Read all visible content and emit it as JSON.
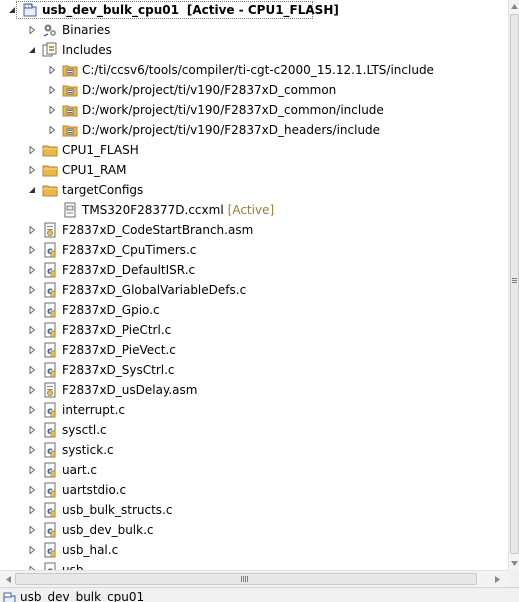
{
  "explorer": {
    "root": {
      "name": "usb_dev_bulk_cpu01",
      "suffix": "[Active - CPU1_FLASH]",
      "icon": "ccs-project-icon",
      "expanded": true
    },
    "rows": [
      {
        "depth": 1,
        "twisty": "collapsed",
        "icon": "binaries",
        "label": "Binaries",
        "name": "tree-item-binaries"
      },
      {
        "depth": 1,
        "twisty": "expanded",
        "icon": "includes",
        "label": "Includes",
        "name": "tree-item-includes"
      },
      {
        "depth": 2,
        "twisty": "collapsed",
        "icon": "include-folder",
        "label": "C:/ti/ccsv6/tools/compiler/ti-cgt-c2000_15.12.1.LTS/include",
        "name": "tree-item-include-compiler"
      },
      {
        "depth": 2,
        "twisty": "collapsed",
        "icon": "include-folder",
        "label": "D:/work/project/ti/v190/F2837xD_common",
        "name": "tree-item-include-common"
      },
      {
        "depth": 2,
        "twisty": "collapsed",
        "icon": "include-folder",
        "label": "D:/work/project/ti/v190/F2837xD_common/include",
        "name": "tree-item-include-common-include"
      },
      {
        "depth": 2,
        "twisty": "collapsed",
        "icon": "include-folder",
        "label": "D:/work/project/ti/v190/F2837xD_headers/include",
        "name": "tree-item-include-headers"
      },
      {
        "depth": 1,
        "twisty": "collapsed",
        "icon": "folder",
        "label": "CPU1_FLASH",
        "name": "tree-item-cpu1-flash"
      },
      {
        "depth": 1,
        "twisty": "collapsed",
        "icon": "folder",
        "label": "CPU1_RAM",
        "name": "tree-item-cpu1-ram"
      },
      {
        "depth": 1,
        "twisty": "expanded",
        "icon": "folder",
        "label": "targetConfigs",
        "name": "tree-item-targetconfigs"
      },
      {
        "depth": 2,
        "twisty": "none",
        "icon": "ccxml",
        "label": "TMS320F28377D.ccxml",
        "suffix": "[Active]",
        "name": "tree-item-ccxml"
      },
      {
        "depth": 1,
        "twisty": "collapsed",
        "icon": "asm",
        "label": "F2837xD_CodeStartBranch.asm",
        "name": "tree-item-codestartbranch"
      },
      {
        "depth": 1,
        "twisty": "collapsed",
        "icon": "c",
        "label": "F2837xD_CpuTimers.c",
        "name": "tree-item-cputimers"
      },
      {
        "depth": 1,
        "twisty": "collapsed",
        "icon": "c",
        "label": "F2837xD_DefaultISR.c",
        "name": "tree-item-defaultisr"
      },
      {
        "depth": 1,
        "twisty": "collapsed",
        "icon": "c",
        "label": "F2837xD_GlobalVariableDefs.c",
        "name": "tree-item-globalvariabledefs"
      },
      {
        "depth": 1,
        "twisty": "collapsed",
        "icon": "c",
        "label": "F2837xD_Gpio.c",
        "name": "tree-item-gpio"
      },
      {
        "depth": 1,
        "twisty": "collapsed",
        "icon": "c",
        "label": "F2837xD_PieCtrl.c",
        "name": "tree-item-piectrl"
      },
      {
        "depth": 1,
        "twisty": "collapsed",
        "icon": "c",
        "label": "F2837xD_PieVect.c",
        "name": "tree-item-pievect"
      },
      {
        "depth": 1,
        "twisty": "collapsed",
        "icon": "c",
        "label": "F2837xD_SysCtrl.c",
        "name": "tree-item-sysctrl"
      },
      {
        "depth": 1,
        "twisty": "collapsed",
        "icon": "asm",
        "label": "F2837xD_usDelay.asm",
        "name": "tree-item-usdelay"
      },
      {
        "depth": 1,
        "twisty": "collapsed",
        "icon": "c",
        "label": "interrupt.c",
        "name": "tree-item-interrupt"
      },
      {
        "depth": 1,
        "twisty": "collapsed",
        "icon": "c",
        "label": "sysctl.c",
        "name": "tree-item-sysctl"
      },
      {
        "depth": 1,
        "twisty": "collapsed",
        "icon": "c",
        "label": "systick.c",
        "name": "tree-item-systick"
      },
      {
        "depth": 1,
        "twisty": "collapsed",
        "icon": "c",
        "label": "uart.c",
        "name": "tree-item-uart"
      },
      {
        "depth": 1,
        "twisty": "collapsed",
        "icon": "c",
        "label": "uartstdio.c",
        "name": "tree-item-uartstdio"
      },
      {
        "depth": 1,
        "twisty": "collapsed",
        "icon": "c",
        "label": "usb_bulk_structs.c",
        "name": "tree-item-usb-bulk-structs"
      },
      {
        "depth": 1,
        "twisty": "collapsed",
        "icon": "c",
        "label": "usb_dev_bulk.c",
        "name": "tree-item-usb-dev-bulk"
      },
      {
        "depth": 1,
        "twisty": "collapsed",
        "icon": "c",
        "label": "usb_hal.c",
        "name": "tree-item-usb-hal"
      },
      {
        "depth": 1,
        "twisty": "collapsed",
        "icon": "c",
        "label": "usb...",
        "name": "tree-item-partial"
      }
    ]
  },
  "status_bar": {
    "label": "usb_dev_bulk_cpu01",
    "icon": "ccs-project-icon"
  },
  "colors": {
    "folder": "#e8b84a",
    "folder_dark": "#b8862a",
    "c_file_blue": "#3d5ea8",
    "suffix": "#9a7b3a"
  }
}
